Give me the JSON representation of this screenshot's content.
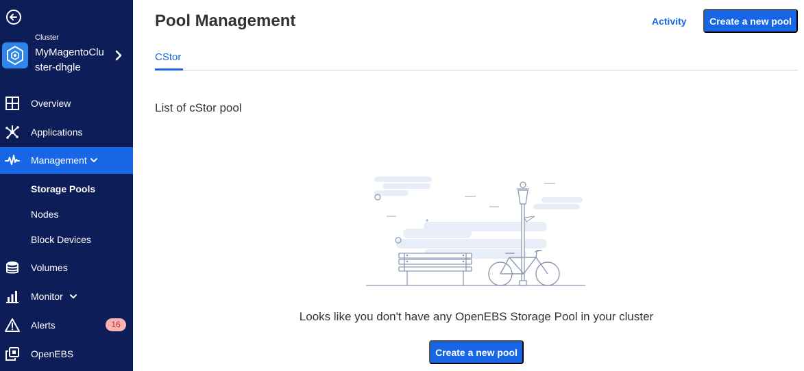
{
  "sidebar": {
    "cluster_caption": "Cluster",
    "cluster_name": "MyMagentoCluster-dhgle",
    "items": [
      {
        "label": "Overview"
      },
      {
        "label": "Applications"
      },
      {
        "label": "Management"
      },
      {
        "label": "Volumes"
      },
      {
        "label": "Monitor"
      },
      {
        "label": "Alerts",
        "badge": "16"
      },
      {
        "label": "OpenEBS"
      }
    ],
    "management_sub": [
      {
        "label": "Storage Pools"
      },
      {
        "label": "Nodes"
      },
      {
        "label": "Block Devices"
      }
    ]
  },
  "header": {
    "title": "Pool Management",
    "activity_label": "Activity",
    "create_label": "Create a new pool"
  },
  "tabs": [
    {
      "label": "CStor"
    }
  ],
  "main": {
    "section_title": "List of cStor pool",
    "empty_message": "Looks like you don't have any OpenEBS Storage Pool in your cluster",
    "create_label": "Create a new pool"
  },
  "colors": {
    "sidebar_bg": "#0d1d57",
    "accent": "#1666e6",
    "badge_bg": "#f8b2b2"
  },
  "icons": {
    "back": "arrow-left-circle-icon",
    "overview": "grid-icon",
    "applications": "network-icon",
    "management": "pulse-icon",
    "volumes": "database-icon",
    "monitor": "bar-chart-icon",
    "alerts": "warning-icon",
    "openebs": "openebs-icon"
  }
}
